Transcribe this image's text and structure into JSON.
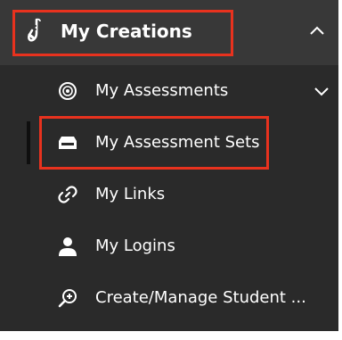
{
  "menu": {
    "header": {
      "label": "My Creations",
      "icon": "saxophone-icon",
      "expanded": true
    },
    "items": [
      {
        "label": "My Assessments",
        "icon": "target-icon",
        "has_submenu": true
      },
      {
        "label": "My Assessment Sets",
        "icon": "tray-icon",
        "active": true
      },
      {
        "label": "My Links",
        "icon": "link-icon"
      },
      {
        "label": "My Logins",
        "icon": "user-icon"
      },
      {
        "label": "Create/Manage Student ...",
        "icon": "search-add-icon"
      }
    ]
  },
  "colors": {
    "panel_bg": "#2a2a2a",
    "header_bg": "#383838",
    "text": "#ffffff",
    "highlight": "#e8321e"
  }
}
